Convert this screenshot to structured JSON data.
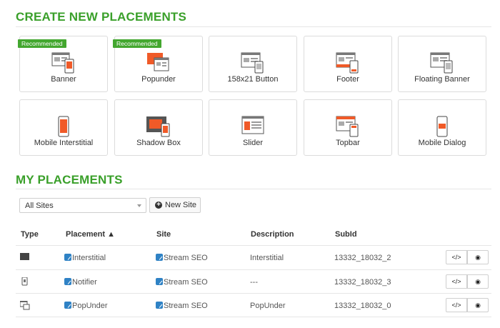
{
  "create": {
    "title": "CREATE NEW PLACEMENTS",
    "cards": [
      {
        "label": "Banner",
        "ribbon": "Recommended",
        "icon": "banner-icon"
      },
      {
        "label": "Popunder",
        "ribbon": "Recommended",
        "icon": "popunder-icon"
      },
      {
        "label": "158x21 Button",
        "ribbon": "",
        "icon": "button-icon"
      },
      {
        "label": "Footer",
        "ribbon": "",
        "icon": "footer-icon"
      },
      {
        "label": "Floating Banner",
        "ribbon": "",
        "icon": "floating-banner-icon"
      },
      {
        "label": "Mobile Interstitial",
        "ribbon": "",
        "icon": "mobile-interstitial-icon"
      },
      {
        "label": "Shadow Box",
        "ribbon": "",
        "icon": "shadow-box-icon"
      },
      {
        "label": "Slider",
        "ribbon": "",
        "icon": "slider-icon"
      },
      {
        "label": "Topbar",
        "ribbon": "",
        "icon": "topbar-icon"
      },
      {
        "label": "Mobile Dialog",
        "ribbon": "",
        "icon": "mobile-dialog-icon"
      }
    ]
  },
  "mine": {
    "title": "MY PLACEMENTS",
    "site_select": "All Sites",
    "new_site": "New Site",
    "columns": [
      "Type",
      "Placement ▲",
      "Site",
      "Description",
      "SubId"
    ],
    "rows": [
      {
        "type_icon": "interstitial-type-icon",
        "placement": "Interstitial",
        "site": "Stream SEO",
        "description": "Interstitial",
        "subid": "13332_18032_2"
      },
      {
        "type_icon": "notifier-type-icon",
        "placement": "Notifier",
        "site": "Stream SEO",
        "description": "---",
        "subid": "13332_18032_3"
      },
      {
        "type_icon": "popunder-type-icon",
        "placement": "PopUnder",
        "site": "Stream SEO",
        "description": "PopUnder",
        "subid": "13332_18032_0"
      }
    ],
    "code_btn": "</>",
    "eye_btn": "◉"
  },
  "colors": {
    "accent": "#3aa02a",
    "ribbon": "#43a72f",
    "icon_orange": "#f05a28",
    "link_icon": "#2f82c5"
  }
}
